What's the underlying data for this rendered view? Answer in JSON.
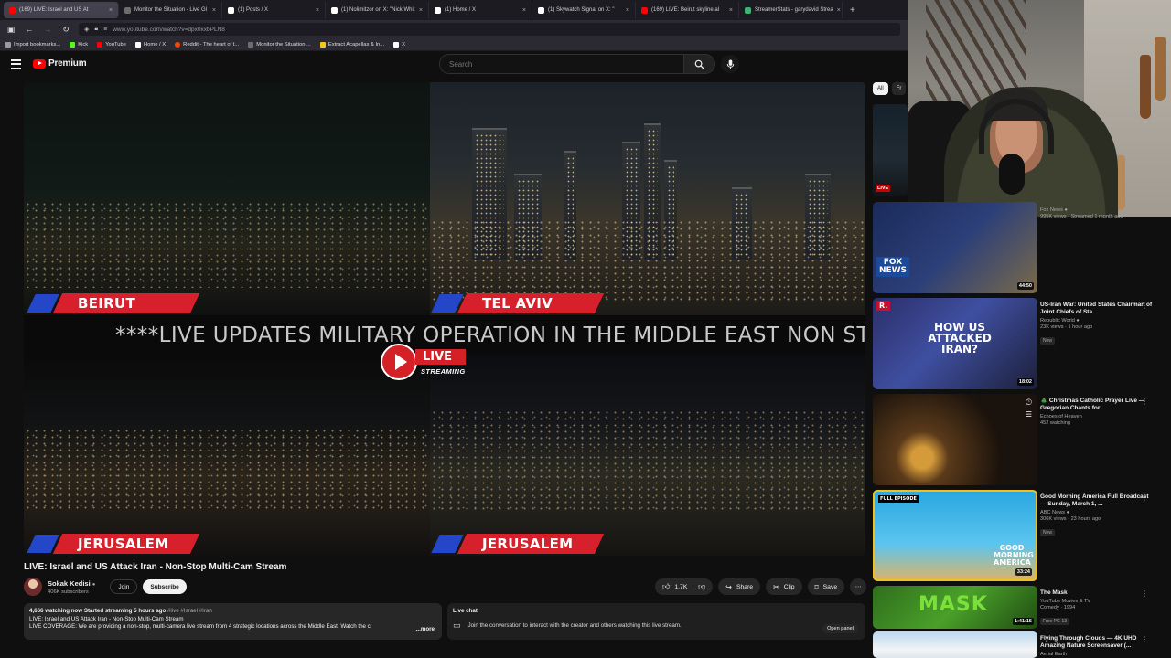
{
  "browser": {
    "tabs": [
      {
        "title": "(169) LIVE: Israel and US At",
        "color": "#ff0000",
        "active": true
      },
      {
        "title": "Monitor the Situation - Live Gl",
        "color": "#6d6d6d",
        "active": false
      },
      {
        "title": "(1) Posts / X",
        "color": "#ffffff",
        "active": false
      },
      {
        "title": "(1) Nolimitzor on X: \"Nick Whit",
        "color": "#ffffff",
        "active": false
      },
      {
        "title": "(1) Home / X",
        "color": "#ffffff",
        "active": false
      },
      {
        "title": "(1) Skywatch Signal on X: \"",
        "color": "#ffffff",
        "active": false
      },
      {
        "title": "(169) LIVE: Beirut skyline al",
        "color": "#ff0000",
        "active": false
      },
      {
        "title": "StreamerStats - garydavid Strea",
        "color": "#3cb371",
        "active": false
      }
    ],
    "url": "www.youtube.com/watch?v=dpx0xxbPLN8",
    "bookmarks": [
      {
        "label": "Import bookmarks...",
        "color": "#9a9aa0"
      },
      {
        "label": "Kick",
        "color": "#53fc18"
      },
      {
        "label": "YouTube",
        "color": "#ff0000"
      },
      {
        "label": "Home / X",
        "color": "#ffffff"
      },
      {
        "label": "Reddit - The heart of t...",
        "color": "#ff4500"
      },
      {
        "label": "Monitor the Situation ...",
        "color": "#6d6d6d"
      },
      {
        "label": "Extract Acapellas & In...",
        "color": "#f5c518"
      },
      {
        "label": "X",
        "color": "#ffffff"
      }
    ]
  },
  "youtube": {
    "logo_text": "Premium",
    "search_placeholder": "Search"
  },
  "player": {
    "cities": {
      "top_left": "BEIRUT",
      "top_right": "TEL AVIV",
      "bottom_left": "JERUSALEM",
      "bottom_right": "JERUSALEM"
    },
    "ticker": "****LIVE UPDATES MILITARY OPERATION IN THE MIDDLE EAST NON STOP",
    "live_label": "LIVE",
    "streaming_label": "STREAMING"
  },
  "video": {
    "title": "LIVE: Israel and US Attack Iran - Non-Stop Multi-Cam Stream",
    "channel": "Sokak Kedisi",
    "subscribers": "406K subscribers",
    "join": "Join",
    "subscribe": "Subscribe",
    "likes": "1.7K",
    "share": "Share",
    "clip": "Clip",
    "save": "Save",
    "description": {
      "meta": "4,666 watching now  Started streaming 5 hours ago",
      "tags": "#live #Israel #Iran",
      "line2": "LIVE: Israel and US Attack Iran - Non-Stop Multi-Cam Stream",
      "line3": "LIVE COVERAGE: We are providing a non-stop, multi-camera live stream from 4 strategic locations across the Middle East. Watch the ci",
      "more": "...more"
    },
    "chat": {
      "label": "Live chat",
      "text": "Join the conversation to interact with the creator and others watching this live stream.",
      "open": "Open panel"
    }
  },
  "sidebar": {
    "chips": [
      "All",
      "Fr"
    ],
    "live_badge": "LIVE",
    "recommendations": [
      {
        "title": "",
        "channel": "Fox News",
        "meta": "995K views · Streamed 1 month ago",
        "duration": "44:50",
        "badge": ""
      },
      {
        "title": "US-Iran War: United States Chairman of Joint Chiefs of Sta...",
        "channel": "Republic World",
        "meta": "23K views · 1 hour ago",
        "duration": "18:02",
        "badge": "New"
      },
      {
        "title": "🎄 Christmas Catholic Prayer Live — Gregorian Chants for ...",
        "channel": "Echoes of Heaven",
        "meta": "452 watching",
        "duration": "",
        "badge": ""
      },
      {
        "title": "Good Morning America Full Broadcast — Sunday, March 1, ...",
        "channel": "ABC News",
        "meta": "306K views · 23 hours ago",
        "duration": "33:24",
        "badge": "New"
      },
      {
        "title": "The Mask",
        "channel": "YouTube Movies & TV",
        "meta": "Comedy · 1994",
        "duration": "1:41:15",
        "badge": "Free  PG-13"
      },
      {
        "title": "Flying Through Clouds — 4K UHD Amazing Nature Screensaver (...",
        "channel": "Aerial Earth",
        "meta": "",
        "duration": "",
        "badge": ""
      }
    ],
    "thumb_text": {
      "fox": "FOX NEWS",
      "republic": "HOW US ATTACKED IRAN?",
      "gma_tag": "FULL EPISODE",
      "gma": "GOOD MORNING AMERICA",
      "mask": "MASK"
    }
  }
}
